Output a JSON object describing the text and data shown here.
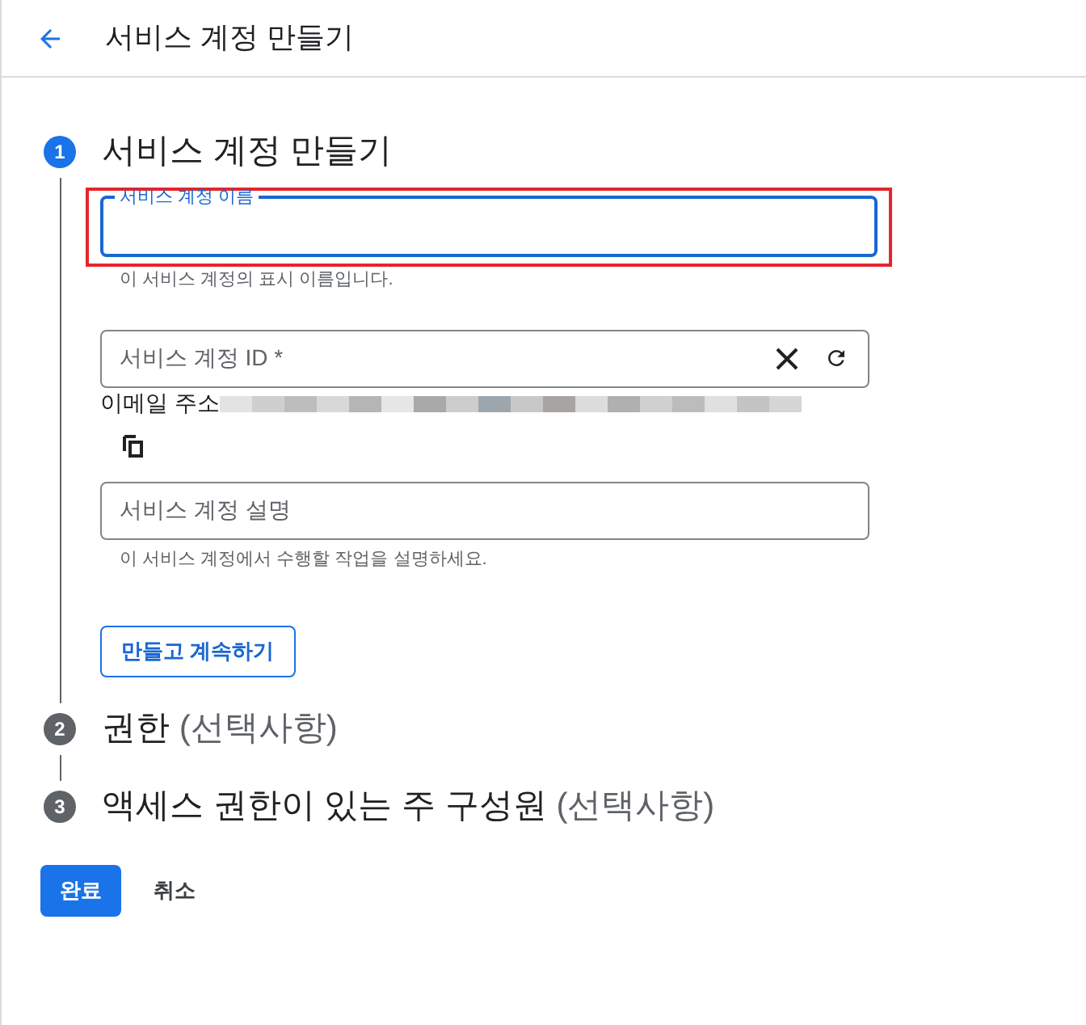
{
  "header": {
    "title": "서비스 계정 만들기"
  },
  "steps": [
    {
      "number": "1",
      "title": "서비스 계정 만들기",
      "selected": true
    },
    {
      "number": "2",
      "title": "권한",
      "suffix": "(선택사항)",
      "selected": false
    },
    {
      "number": "3",
      "title": "액세스 권한이 있는 주 구성원",
      "suffix": "(선택사항)",
      "selected": false
    }
  ],
  "form": {
    "name_field": {
      "label": "서비스 계정 이름",
      "focused": true,
      "hint": "이 서비스 계정의 표시 이름입니다."
    },
    "id_field": {
      "placeholder": "서비스 계정 ID *"
    },
    "email_label": "이메일 주소",
    "description_field": {
      "placeholder": "서비스 계정 설명",
      "hint": "이 서비스 계정에서 수행할 작업을 설명하세요."
    },
    "continue_button": "만들고 계속하기"
  },
  "footer": {
    "done_button": "완료",
    "cancel_button": "취소"
  }
}
